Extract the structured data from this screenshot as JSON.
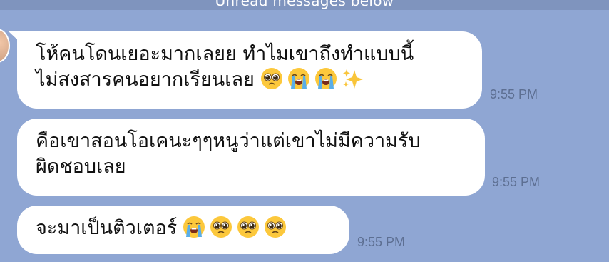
{
  "banner": {
    "text": "Unread messages below"
  },
  "messages": [
    {
      "lines": [
        "โห้คนโดนเยอะมากเลยย ทำไมเขาถึงทำแบบนี้",
        "ไม่สงสารคนอยากเรียนเลย"
      ],
      "emojis": [
        "pleading-face",
        "loudly-crying-face",
        "loudly-crying-face",
        "sparkles"
      ],
      "time": "9:55 PM"
    },
    {
      "lines": [
        "คือเขาสอนโอเคนะๆๆหนูว่าแต่เขาไม่มีความรับ",
        "ผิดชอบเลย"
      ],
      "emojis": [],
      "time": "9:55 PM"
    },
    {
      "lines": [
        "จะมาเป็นติวเตอร์"
      ],
      "emojis": [
        "loudly-crying-face",
        "pleading-face",
        "pleading-face",
        "pleading-face"
      ],
      "time": "9:55 PM"
    }
  ],
  "colors": {
    "background": "#8fa6d3",
    "bubble": "#ffffff",
    "timestamp": "#5d6f92"
  }
}
